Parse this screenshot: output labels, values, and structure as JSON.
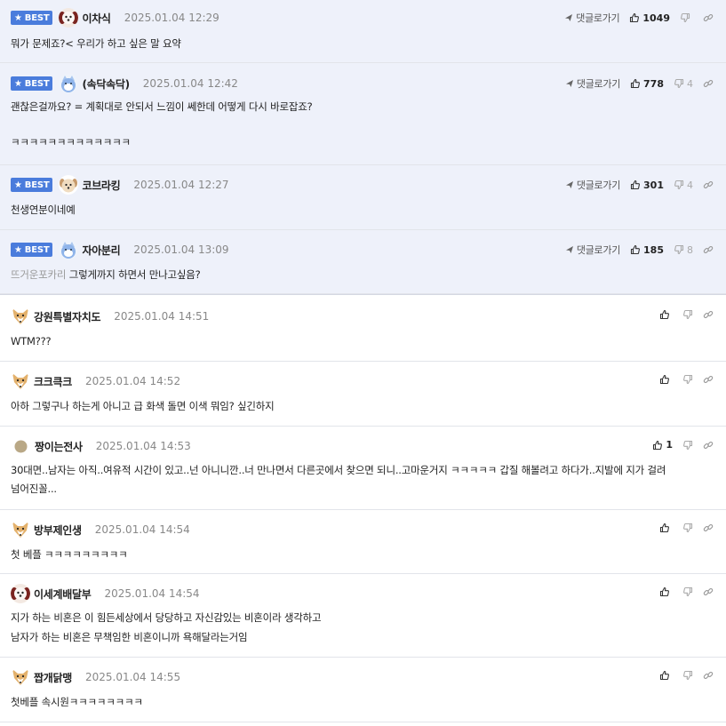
{
  "ui": {
    "best_label": "BEST",
    "reply_link": "댓글로가기",
    "colors": {
      "best_bg": "#eef1fa",
      "badge": "#4a7cdc"
    }
  },
  "best_comments": [
    {
      "nick": "이차식",
      "time": "2025.01.04 12:29",
      "avatar": "dog-red-icon",
      "up": "1049",
      "down": "",
      "lines": [
        "뭐가 문제죠?< 우리가 하고 싶은 말 요약"
      ]
    },
    {
      "nick": "(속닥속닥)",
      "time": "2025.01.04 12:42",
      "avatar": "cat-blue-icon",
      "up": "778",
      "down": "4",
      "lines": [
        "괜찮은걸까요? = 계획대로 안되서 느낌이 쎄한데 어떻게 다시 바로잡죠?",
        "",
        "ㅋㅋㅋㅋㅋㅋㅋㅋㅋㅋㅋㅋㅋ"
      ]
    },
    {
      "nick": "코브라킹",
      "time": "2025.01.04 12:27",
      "avatar": "puppy-icon",
      "up": "301",
      "down": "4",
      "lines": [
        "천생연분이네예"
      ]
    },
    {
      "nick": "자아분리",
      "time": "2025.01.04 13:09",
      "avatar": "cat-blue-icon",
      "up": "185",
      "down": "8",
      "reply_to": "뜨거운포카리",
      "lines": [
        "그렇게까지 하면서 만나고싶음?"
      ]
    }
  ],
  "comments": [
    {
      "nick": "강원특별자치도",
      "time": "2025.01.04 14:51",
      "avatar": "fox-icon",
      "up": "",
      "lines": [
        "WTM???"
      ]
    },
    {
      "nick": "크크큭크",
      "time": "2025.01.04 14:52",
      "avatar": "fox-icon",
      "up": "",
      "lines": [
        "아하 그렇구나 하는게 아니고 급 화색 돌면 이색 뭐임? 싶긴하지"
      ]
    },
    {
      "nick": "짱이는전사",
      "time": "2025.01.04 14:53",
      "avatar": "dot-icon",
      "up": "1",
      "lines": [
        "30대면..남자는 아직..여유적 시간이 있고..넌 아니니깐..너 만나면서 다른곳에서 찾으면 되니..고마운거지 ㅋㅋㅋㅋㅋ 갑질 해볼려고 하다가..지발에 지가 걸려",
        "넘어진꼴..."
      ]
    },
    {
      "nick": "방부제인생",
      "time": "2025.01.04 14:54",
      "avatar": "fox-icon",
      "up": "",
      "lines": [
        "첫 베플 ㅋㅋㅋㅋㅋㅋㅋㅋㅋ"
      ]
    },
    {
      "nick": "이세계배달부",
      "time": "2025.01.04 14:54",
      "avatar": "dog-red-icon",
      "up": "",
      "lines": [
        "지가 하는 비혼은 이 힘든세상에서 당당하고 자신감있는 비혼이라 생각하고",
        "남자가 하는 비혼은 무책임한 비혼이니까 욕해달라는거임"
      ]
    },
    {
      "nick": "짭개닭맹",
      "time": "2025.01.04 14:55",
      "avatar": "fox-icon",
      "up": "",
      "lines": [
        "첫베플 속시원ㅋㅋㅋㅋㅋㅋㅋㅋ"
      ]
    }
  ]
}
